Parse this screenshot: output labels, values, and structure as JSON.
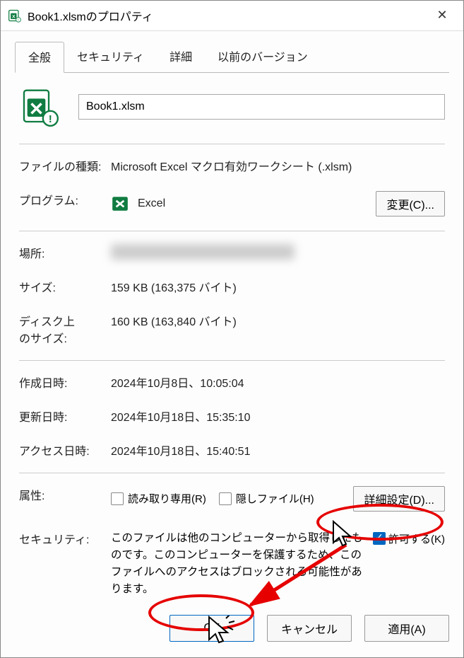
{
  "window": {
    "title": "Book1.xlsmのプロパティ",
    "close_glyph": "✕"
  },
  "tabs": {
    "general": "全般",
    "security": "セキュリティ",
    "details": "詳細",
    "prev_versions": "以前のバージョン"
  },
  "file": {
    "name": "Book1.xlsm"
  },
  "rows": {
    "type_label": "ファイルの種類:",
    "type_value": "Microsoft Excel マクロ有効ワークシート (.xlsm)",
    "program_label": "プログラム:",
    "program_value": "Excel",
    "change_button": "変更(C)...",
    "location_label": "場所:",
    "size_label": "サイズ:",
    "size_value": "159 KB (163,375 バイト)",
    "disk_label": "ディスク上\nのサイズ:",
    "disk_value": "160 KB (163,840 バイト)",
    "created_label": "作成日時:",
    "created_value": "2024年10月8日、10:05:04",
    "modified_label": "更新日時:",
    "modified_value": "2024年10月18日、15:35:10",
    "accessed_label": "アクセス日時:",
    "accessed_value": "2024年10月18日、15:40:51",
    "attr_label": "属性:",
    "attr_readonly": "読み取り専用(R)",
    "attr_hidden": "隠しファイル(H)",
    "attr_advanced": "詳細設定(D)...",
    "sec_label": "セキュリティ:",
    "sec_text": "このファイルは他のコンピューターから取得したものです。このコンピューターを保護するため、このファイルへのアクセスはブロックされる可能性があります。",
    "sec_allow": "許可する(K)"
  },
  "footer": {
    "ok": "OK",
    "cancel": "キャンセル",
    "apply": "適用(A)"
  }
}
